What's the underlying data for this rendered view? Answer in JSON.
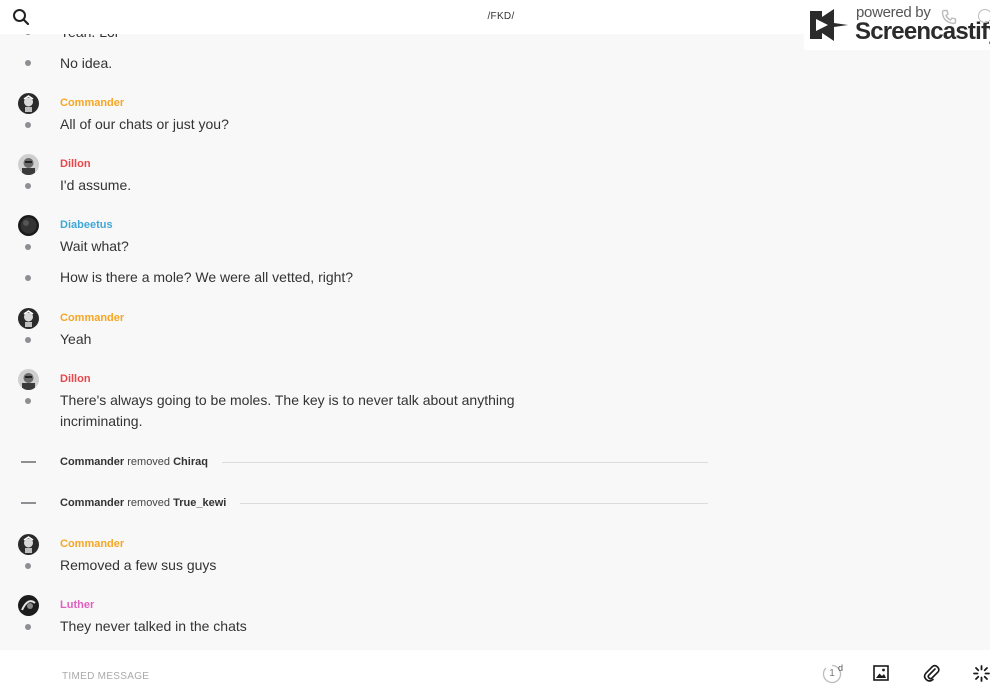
{
  "header": {
    "title": "/FKD/"
  },
  "watermark": {
    "line1": "powered by",
    "line2": "Screencastify"
  },
  "colors": {
    "commander": "#f5a623",
    "dillon": "#e8474a",
    "diabeetus": "#3fa7d6",
    "luther": "#e060c0",
    "bullet": "#8e8e93"
  },
  "messages": {
    "m0": {
      "text": "Yeah. Lol"
    },
    "m1": {
      "text": "No idea."
    },
    "m2": {
      "sender": "Commander",
      "text": "All of our chats or just you?"
    },
    "m3": {
      "sender": "Dillon",
      "text": "I'd assume."
    },
    "m4": {
      "sender": "Diabeetus",
      "text": "Wait what?"
    },
    "m5": {
      "text": "How is there a mole? We were all vetted, right?"
    },
    "m6": {
      "sender": "Commander",
      "text": "Yeah"
    },
    "m7": {
      "sender": "Dillon",
      "line1": "There's always going to be moles. The key is to never talk about anything",
      "line2": "incriminating."
    },
    "m10": {
      "sender": "Commander",
      "text": "Removed a few sus guys"
    },
    "m11": {
      "sender": "Luther",
      "text": "They never talked in the chats"
    }
  },
  "system_events": [
    {
      "actor": "Commander",
      "action": "removed",
      "target": "Chiraq"
    },
    {
      "actor": "Commander",
      "action": "removed",
      "target": "True_kewi"
    }
  ],
  "composer": {
    "placeholder": "TIMED MESSAGE",
    "timer_value": "1",
    "timer_unit": "d"
  },
  "icons": {
    "search": "search-icon",
    "phone": "phone-icon",
    "info": "info-icon",
    "image": "image-icon",
    "attach": "paperclip-icon",
    "burst": "sparkle-icon"
  }
}
